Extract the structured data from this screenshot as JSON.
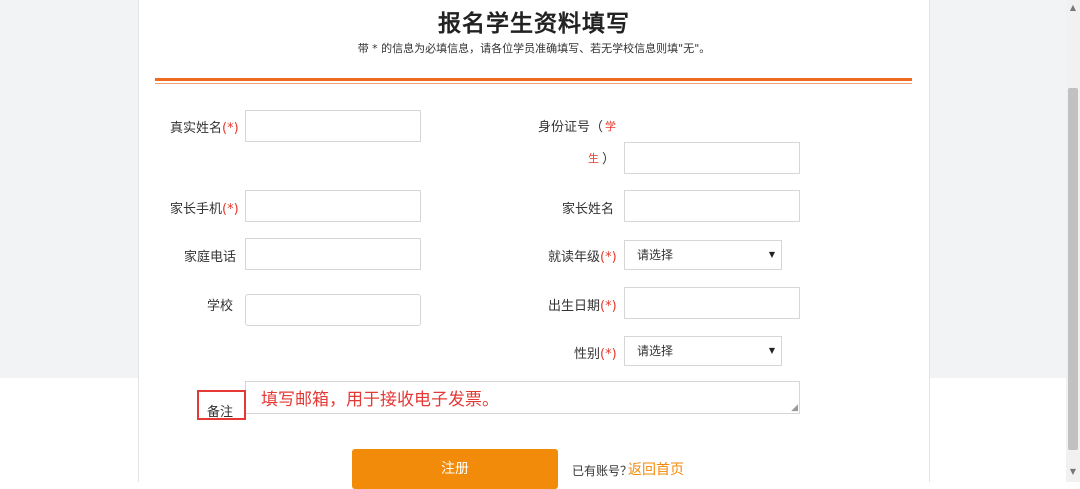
{
  "form": {
    "title": "报名学生资料填写",
    "notice": "带 * 的信息为必填信息，请各位学员准确填写、若无学校信息则填\"无\"。",
    "fields": {
      "real_name": {
        "label": "真实姓名",
        "required_mark": "(*)"
      },
      "id_number": {
        "label": "身份证号（",
        "paren_open": "",
        "student_1": "学",
        "student_2": "生",
        "paren_close": "）"
      },
      "parent_phone": {
        "label": "家长手机",
        "required_mark": "(*)"
      },
      "parent_name": {
        "label": "家长姓名"
      },
      "home_phone": {
        "label": "家庭电话"
      },
      "grade": {
        "label": "就读年级",
        "required_mark": "(*)",
        "selected": "请选择"
      },
      "school": {
        "label": "学校"
      },
      "birth_date": {
        "label": "出生日期",
        "required_mark": "(*)"
      },
      "gender": {
        "label": "性别",
        "required_mark": "(*)",
        "selected": "请选择"
      },
      "remark": {
        "label": "备注"
      }
    },
    "annotation": "填写邮箱，用于接收电子发票。",
    "submit_label": "注册",
    "login_prompt": "已有账号？",
    "login_link": "返回首页"
  },
  "icons": {
    "select_arrow": "▼",
    "scroll_up": "▲",
    "scroll_down": "▼",
    "resize_grip": "◢"
  },
  "colors": {
    "accent": "#f28a0a",
    "divider": "#ee6b1f",
    "required": "#e5392c",
    "annotation": "#e53935"
  }
}
